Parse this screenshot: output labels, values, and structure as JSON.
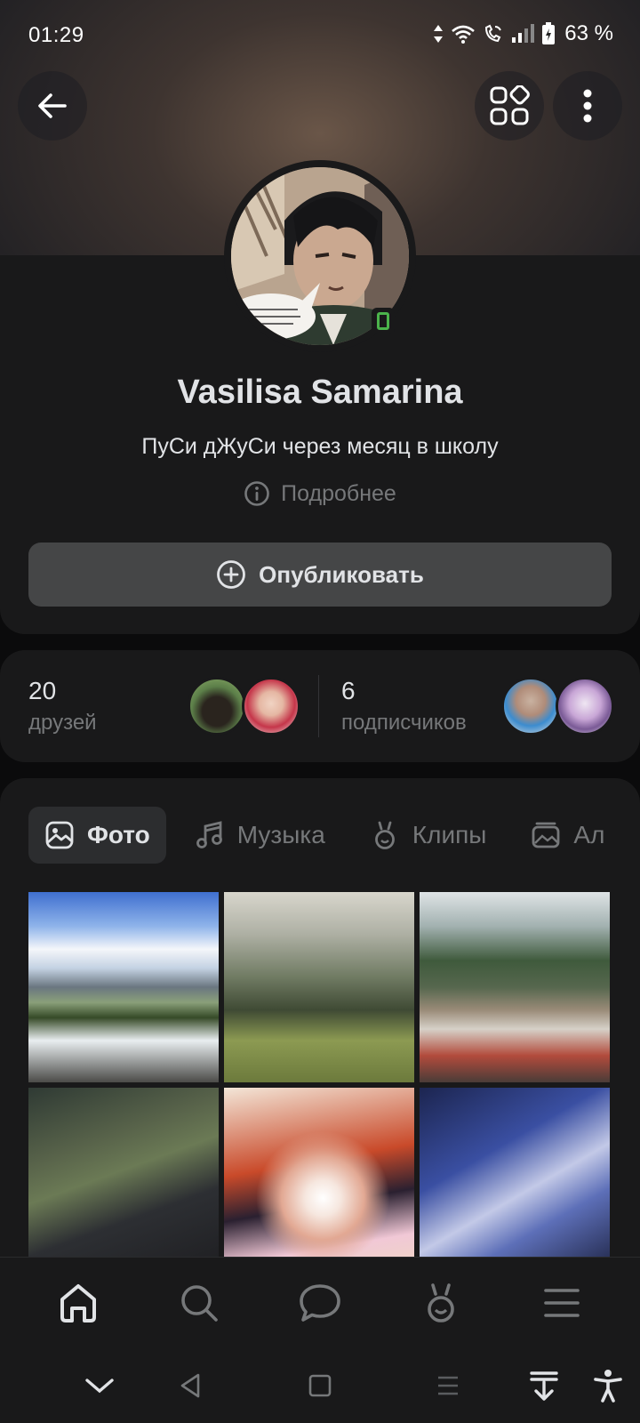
{
  "status_bar": {
    "time": "01:29",
    "battery": "63 %"
  },
  "profile": {
    "name": "Vasilisa Samarina",
    "status": "ПуСи дЖуСи через месяц в школу",
    "details_label": "Подробнее",
    "publish_label": "Опубликовать",
    "avatar_speech": "SOME PEOPLE ARE OK, BUT MOSTLY I JUST FEEL LIKE KILLING EVERYBODY."
  },
  "counters": {
    "friends": {
      "count": "20",
      "label": "друзей"
    },
    "followers": {
      "count": "6",
      "label": "подписчиков"
    }
  },
  "tabs": [
    {
      "label": "Фото",
      "icon": "image-icon",
      "active": true
    },
    {
      "label": "Музыка",
      "icon": "music-icon",
      "active": false
    },
    {
      "label": "Клипы",
      "icon": "clips-icon",
      "active": false
    },
    {
      "label": "Ал",
      "icon": "album-icon",
      "active": false
    }
  ],
  "photos": [
    {
      "subject": "waterfall"
    },
    {
      "subject": "foggy-meadow"
    },
    {
      "subject": "lake-with-book"
    },
    {
      "subject": "bus-window"
    },
    {
      "subject": "anime-illustration"
    },
    {
      "subject": "blue-fabric"
    }
  ],
  "bottom_nav": [
    "home-icon",
    "search-icon",
    "messages-icon",
    "clips-icon",
    "menu-icon"
  ],
  "colors": {
    "background": "#19191a",
    "text_primary": "#e1e3e6",
    "text_secondary": "#76787a",
    "button": "#454647",
    "online": "#4bb34b"
  }
}
